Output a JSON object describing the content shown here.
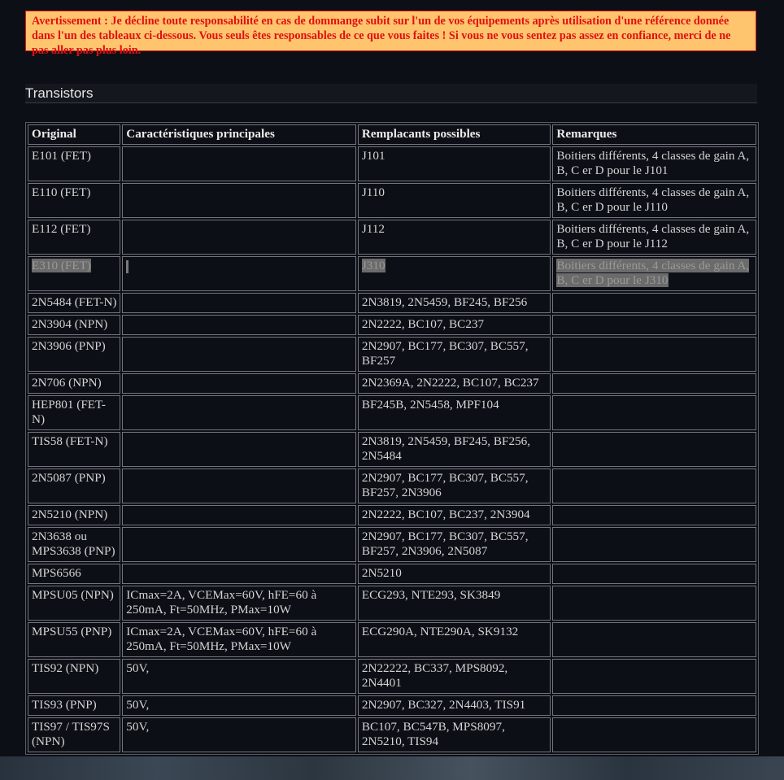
{
  "warning": "Avertissement : Je décline toute responsabilité en cas de dommange subit sur l'un de vos équipements après utilisation d'une référence donnée dans l'un des tableaux ci-dessous. Vous seuls êtes responsables de ce que vous faites ! Si vous ne vous sentez pas assez en confiance, merci de ne pas aller pas plus loin.",
  "section_title": "Transistors",
  "table": {
    "headers": [
      "Original",
      "Caractéristiques principales",
      "Remplacants possibles",
      "Remarques"
    ],
    "rows": [
      [
        "E101 (FET)",
        "",
        "J101",
        "Boitiers différents, 4 classes de gain A, B, C er D pour le J101"
      ],
      [
        "E110 (FET)",
        "",
        "J110",
        "Boitiers différents, 4 classes de gain A, B, C er D pour le J110"
      ],
      [
        "E112 (FET)",
        "",
        "J112",
        "Boitiers différents, 4 classes de gain A, B, C er D pour le J112"
      ],
      [
        "E310 (FET)",
        "",
        "J310",
        "Boitiers différents, 4 classes de gain A, B, C er D pour le J310"
      ],
      [
        "2N5484 (FET-N)",
        "",
        "2N3819, 2N5459, BF245, BF256",
        ""
      ],
      [
        "2N3904 (NPN)",
        "",
        "2N2222, BC107, BC237",
        ""
      ],
      [
        "2N3906 (PNP)",
        "",
        "2N2907, BC177, BC307, BC557, BF257",
        ""
      ],
      [
        "2N706 (NPN)",
        "",
        "2N2369A, 2N2222, BC107, BC237",
        ""
      ],
      [
        "HEP801 (FET-N)",
        "",
        "BF245B, 2N5458, MPF104",
        ""
      ],
      [
        "TIS58 (FET-N)",
        "",
        "2N3819, 2N5459, BF245, BF256, 2N5484",
        ""
      ],
      [
        "2N5087 (PNP)",
        "",
        "2N2907, BC177, BC307, BC557, BF257, 2N3906",
        ""
      ],
      [
        "2N5210 (NPN)",
        "",
        "2N2222, BC107, BC237, 2N3904",
        ""
      ],
      [
        "2N3638 ou MPS3638 (PNP)",
        "",
        "2N2907, BC177, BC307, BC557, BF257, 2N3906, 2N5087",
        ""
      ],
      [
        "MPS6566",
        "",
        "2N5210",
        ""
      ],
      [
        "MPSU05 (NPN)",
        "ICmax=2A, VCEMax=60V, hFE=60 à 250mA, Ft=50MHz, PMax=10W",
        "ECG293, NTE293, SK3849",
        ""
      ],
      [
        "MPSU55 (PNP)",
        "ICmax=2A, VCEMax=60V, hFE=60 à 250mA, Ft=50MHz, PMax=10W",
        "ECG290A, NTE290A, SK9132",
        ""
      ],
      [
        "TIS92 (NPN)",
        "50V,",
        "2N22222, BC337, MPS8092, 2N4401",
        ""
      ],
      [
        "TIS93 (PNP)",
        "50V,",
        "2N2907, BC327, 2N4403, TIS91",
        ""
      ],
      [
        "TIS97 / TIS97S (NPN)",
        "50V,",
        "BC107, BC547B, MPS8097, 2N5210, TIS94",
        ""
      ]
    ],
    "selected_row": 3
  }
}
